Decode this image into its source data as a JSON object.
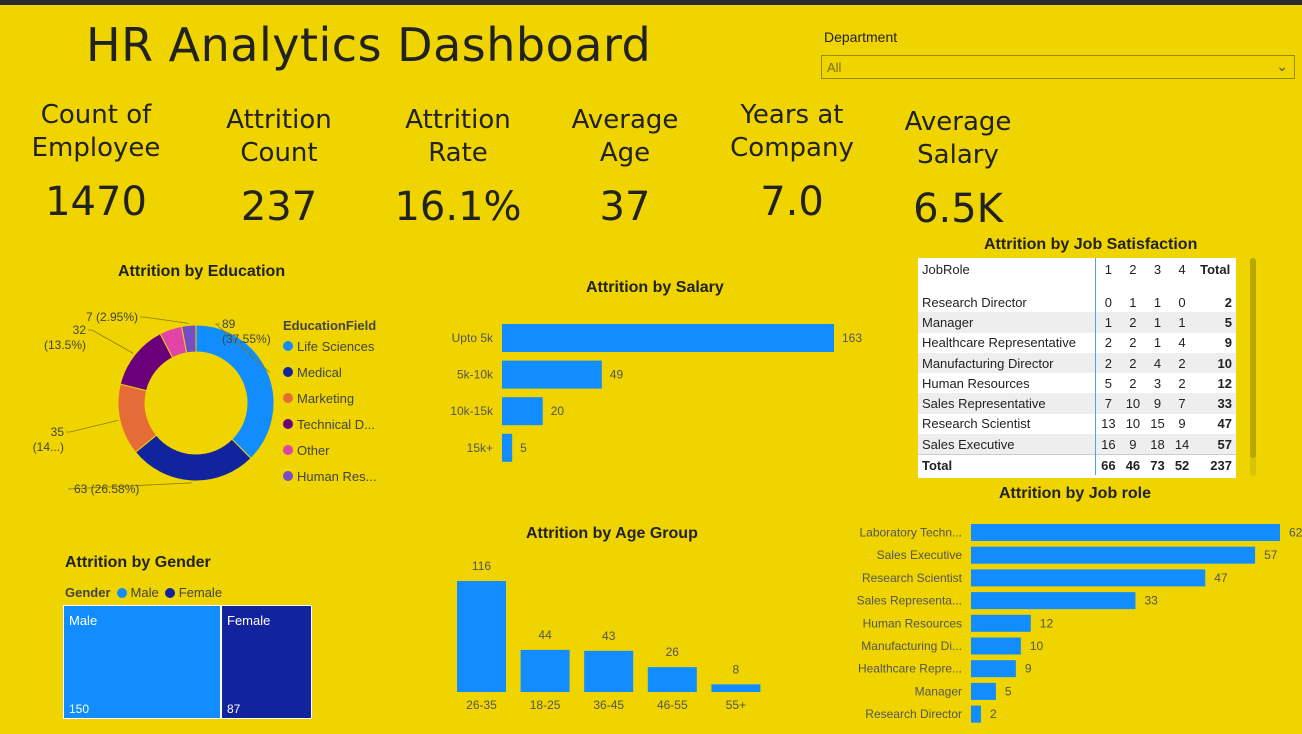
{
  "title": "HR Analytics Dashboard",
  "filter": {
    "label": "Department",
    "value": "All"
  },
  "kpis": [
    {
      "label_line1": "Count of",
      "label_line2": "Employee",
      "value": "1470"
    },
    {
      "label_line1": "Attrition",
      "label_line2": "Count",
      "value": "237"
    },
    {
      "label_line1": "Attrition",
      "label_line2": "Rate",
      "value": "16.1%"
    },
    {
      "label_line1": "Average",
      "label_line2": "Age",
      "value": "37"
    },
    {
      "label_line1": "Years at",
      "label_line2": "Company",
      "value": "7.0"
    },
    {
      "label_line1": "Average",
      "label_line2": "Salary",
      "value": "6.5K"
    }
  ],
  "colors": {
    "background": "#efd400",
    "bar_blue": "#118dff",
    "dark_blue": "#12239e",
    "orange": "#e66c37",
    "purple": "#6b007b",
    "pink": "#e044a7",
    "violet": "#744ec2"
  },
  "chart_data": [
    {
      "type": "pie",
      "title": "Attrition by Education",
      "legend_title": "EducationField",
      "legend_labels": [
        "Life Sciences",
        "Medical",
        "Marketing",
        "Technical D...",
        "Other",
        "Human Res..."
      ],
      "series": [
        {
          "name": "Life Sciences",
          "value": 89,
          "label_line1": "89",
          "label_line2": "(37.55%)"
        },
        {
          "name": "Medical",
          "value": 63,
          "label_line1": "63 (26.58%)",
          "label_line2": ""
        },
        {
          "name": "Marketing",
          "value": 35,
          "label_line1": "35",
          "label_line2": "(14...)"
        },
        {
          "name": "Technical Degree",
          "value": 32,
          "label_line1": "32",
          "label_line2": "(13.5%)"
        },
        {
          "name": "Other",
          "value": 11,
          "label_line1": "",
          "label_line2": ""
        },
        {
          "name": "Human Resources",
          "value": 7,
          "label_line1": "7 (2.95%)",
          "label_line2": ""
        }
      ]
    },
    {
      "type": "bar",
      "title": "Attrition by Salary",
      "categories": [
        "Upto 5k",
        "5k-10k",
        "10k-15k",
        "15k+"
      ],
      "values": [
        163,
        49,
        20,
        5
      ]
    },
    {
      "type": "table",
      "title": "Attrition by Job Satisfaction",
      "columns": [
        "JobRole",
        "1",
        "2",
        "3",
        "4",
        "Total"
      ],
      "rows": [
        [
          "Research Director",
          0,
          1,
          1,
          0,
          2
        ],
        [
          "Manager",
          1,
          2,
          1,
          1,
          5
        ],
        [
          "Healthcare Representative",
          2,
          2,
          1,
          4,
          9
        ],
        [
          "Manufacturing Director",
          2,
          2,
          4,
          2,
          10
        ],
        [
          "Human Resources",
          5,
          2,
          3,
          2,
          12
        ],
        [
          "Sales Representative",
          7,
          10,
          9,
          7,
          33
        ],
        [
          "Research Scientist",
          13,
          10,
          15,
          9,
          47
        ],
        [
          "Sales Executive",
          16,
          9,
          18,
          14,
          57
        ]
      ],
      "total": [
        "Total",
        66,
        46,
        73,
        52,
        237
      ]
    },
    {
      "type": "bar",
      "title": "Attrition by Age Group",
      "categories": [
        "26-35",
        "18-25",
        "36-45",
        "46-55",
        "55+"
      ],
      "values": [
        116,
        44,
        43,
        26,
        8
      ]
    },
    {
      "type": "bar",
      "title": "Attrition by Job role",
      "categories": [
        "Laboratory Techn...",
        "Sales Executive",
        "Research Scientist",
        "Sales Representa...",
        "Human Resources",
        "Manufacturing Di...",
        "Healthcare Repre...",
        "Manager",
        "Research Director"
      ],
      "values": [
        62,
        57,
        47,
        33,
        12,
        10,
        9,
        5,
        2
      ]
    },
    {
      "type": "treemap",
      "title": "Attrition by Gender",
      "legend_title": "Gender",
      "legend_labels": [
        "Male",
        "Female"
      ],
      "categories": [
        "Male",
        "Female"
      ],
      "values": [
        150,
        87
      ]
    }
  ]
}
